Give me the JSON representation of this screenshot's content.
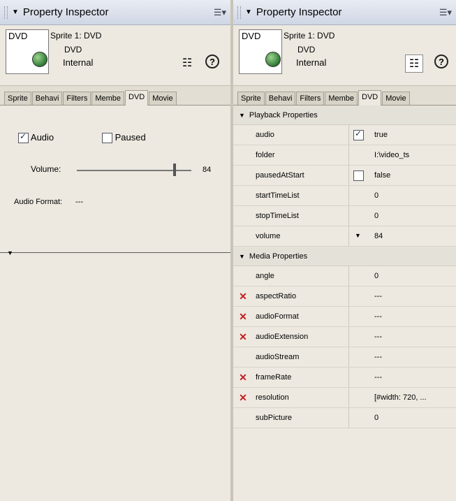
{
  "left_panel": {
    "title": "Property Inspector",
    "sprite_label": "Sprite 1: DVD",
    "member_name": "DVD",
    "member_location": "Internal",
    "thumb_label": "DVD",
    "tabs": [
      "Sprite",
      "Behavi",
      "Filters",
      "Membe",
      "DVD",
      "Movie"
    ],
    "active_tab": "DVD",
    "audio_label": "Audio",
    "audio_checked": true,
    "paused_label": "Paused",
    "paused_checked": false,
    "volume_label": "Volume:",
    "volume_value": "84",
    "volume_fraction": 0.84,
    "audio_format_label": "Audio Format:",
    "audio_format_value": "---"
  },
  "right_panel": {
    "title": "Property Inspector",
    "sprite_label": "Sprite 1: DVD",
    "member_name": "DVD",
    "member_location": "Internal",
    "thumb_label": "DVD",
    "tabs": [
      "Sprite",
      "Behavi",
      "Filters",
      "Membe",
      "DVD",
      "Movie"
    ],
    "active_tab": "DVD",
    "sections": [
      {
        "title": "Playback Properties",
        "rows": [
          {
            "name": "audio",
            "value": "true",
            "control": "checkbox-on",
            "error": false
          },
          {
            "name": "folder",
            "value": "I:\\video_ts",
            "control": "",
            "error": false
          },
          {
            "name": "pausedAtStart",
            "value": "false",
            "control": "checkbox-off",
            "error": false
          },
          {
            "name": "startTimeList",
            "value": "0",
            "control": "",
            "error": false
          },
          {
            "name": "stopTimeList",
            "value": "0",
            "control": "",
            "error": false
          },
          {
            "name": "volume",
            "value": "84",
            "control": "dropdown",
            "error": false
          }
        ]
      },
      {
        "title": "Media Properties",
        "rows": [
          {
            "name": "angle",
            "value": "0",
            "control": "",
            "error": false
          },
          {
            "name": "aspectRatio",
            "value": "---",
            "control": "",
            "error": true
          },
          {
            "name": "audioFormat",
            "value": "---",
            "control": "",
            "error": true
          },
          {
            "name": "audioExtension",
            "value": "---",
            "control": "",
            "error": true
          },
          {
            "name": "audioStream",
            "value": "---",
            "control": "",
            "error": false
          },
          {
            "name": "frameRate",
            "value": "---",
            "control": "",
            "error": true
          },
          {
            "name": "resolution",
            "value": "[#width: 720, ...",
            "control": "",
            "error": true
          },
          {
            "name": "subPicture",
            "value": "0",
            "control": "",
            "error": false
          }
        ]
      }
    ]
  },
  "icons": {
    "panel_options": "options-menu-icon",
    "collapse": "collapse-triangle-icon",
    "globe": "globe-icon",
    "list_view": "list-view-icon",
    "help": "help-icon",
    "error_mark": "error-x-icon"
  },
  "colors": {
    "title_bar": "#cfd6e4",
    "panel_bg": "#ede9e0",
    "error": "#c21e1e"
  }
}
